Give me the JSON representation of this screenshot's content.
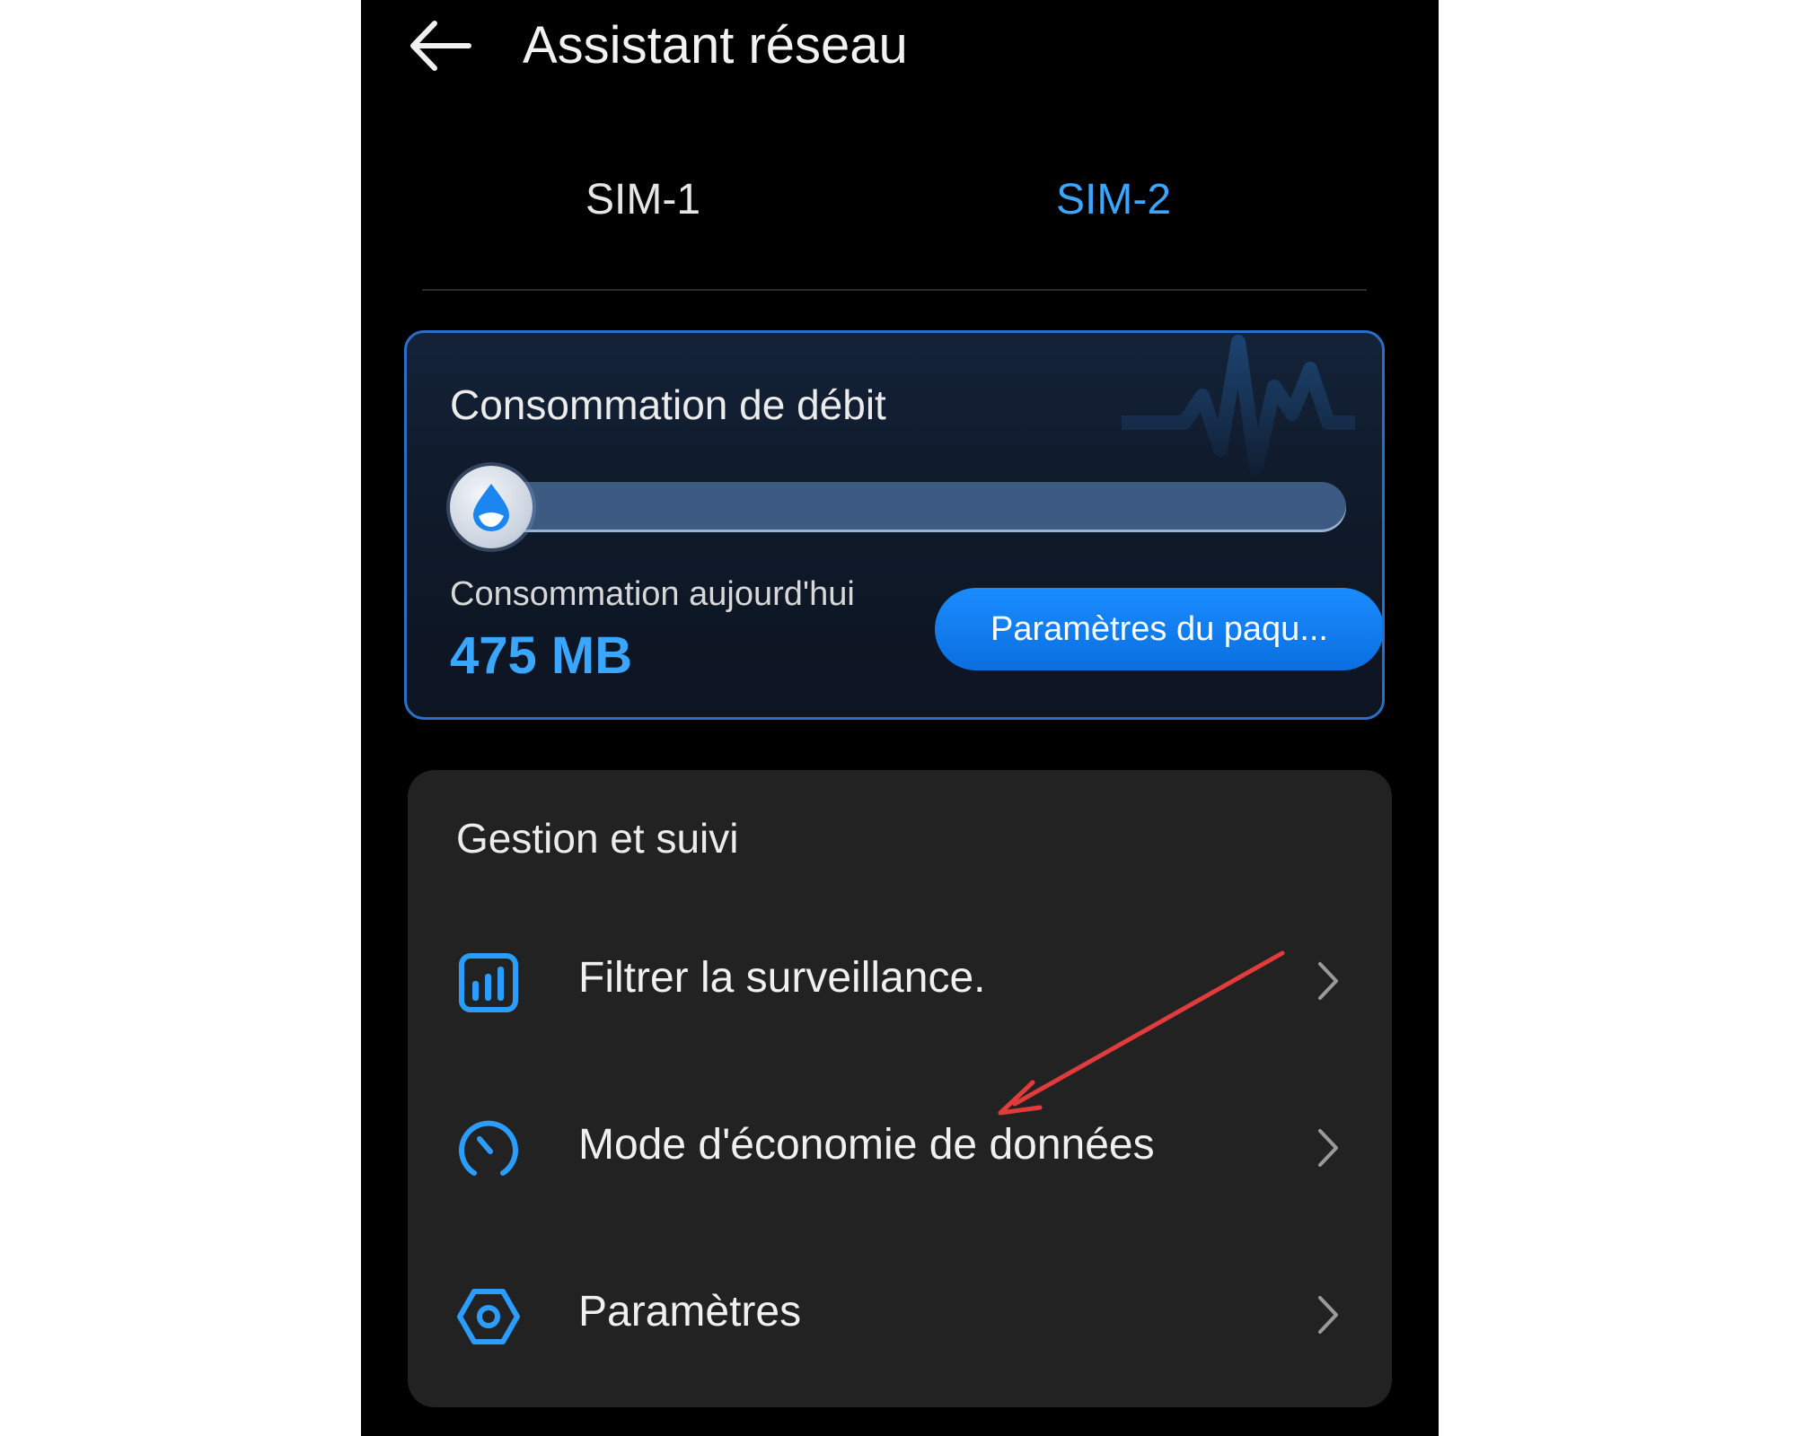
{
  "header": {
    "title": "Assistant réseau",
    "back_icon": "arrow-left-icon"
  },
  "tabs": [
    {
      "label": "SIM-1",
      "selected": false
    },
    {
      "label": "SIM-2",
      "selected": true
    }
  ],
  "consumption_card": {
    "title": "Consommation de débit",
    "usage_fraction": 0.0,
    "knob_icon": "water-drop-icon",
    "today_label": "Consommation aujourd'hui",
    "today_value": "475 MB",
    "package_button_label": "Paramètres du paqu..."
  },
  "management": {
    "title": "Gestion et suivi",
    "items": [
      {
        "label": "Filtrer la surveillance.",
        "icon": "bar-chart-icon"
      },
      {
        "label": "Mode d'économie de données",
        "icon": "speedometer-icon"
      },
      {
        "label": "Paramètres",
        "icon": "hexagon-settings-icon"
      }
    ]
  },
  "colors": {
    "accent": "#3aa6ff",
    "button": "#0a7bf0",
    "card_border": "#2a6fc7",
    "annotation_arrow": "#e23b3b"
  }
}
